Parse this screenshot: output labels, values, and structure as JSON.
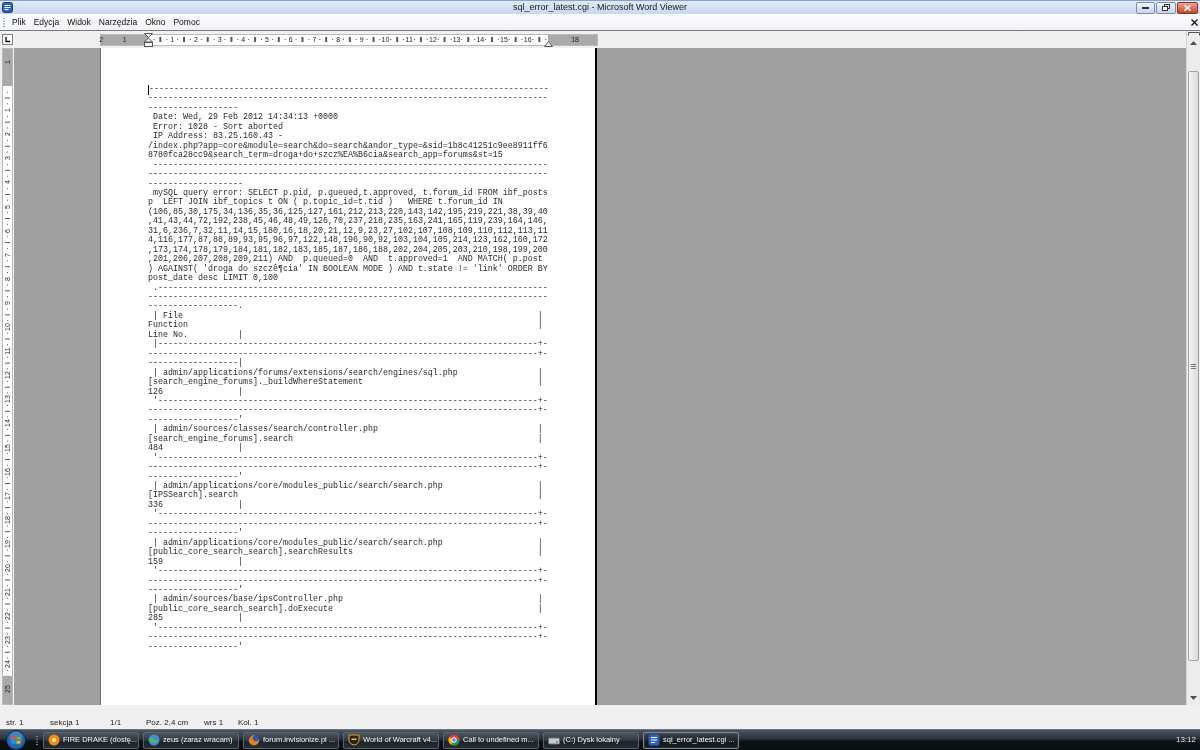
{
  "window": {
    "title": "sql_error_latest.cgi - Microsoft Word Viewer"
  },
  "menu_bar": {
    "items": [
      "Plik",
      "Edycja",
      "Widok",
      "Narzędzia",
      "Okno",
      "Pomoc"
    ]
  },
  "horizontal_ruler": {
    "left_margin_labels": [
      "2",
      "1"
    ],
    "labels": [
      "1",
      "2",
      "3",
      "4",
      "5",
      "6",
      "7",
      "8",
      "9",
      "10",
      "11",
      "12",
      "13",
      "14",
      "15",
      "16"
    ],
    "right_margin_labels": [
      "18"
    ]
  },
  "vertical_ruler": {
    "top_margin_labels": [
      "1"
    ],
    "labels": [
      "1",
      "2",
      "3",
      "4",
      "5",
      "6",
      "7",
      "8",
      "9",
      "10",
      "11",
      "12",
      "13",
      "14",
      "15",
      "16",
      "17",
      "18",
      "19",
      "20",
      "21",
      "22",
      "23",
      "24"
    ],
    "bottom_margin_labels": [
      "25"
    ]
  },
  "document": {
    "lines": [
      "--------------------------------------------------------------------------------",
      "--------------------------------------------------------------------------------",
      "------------------",
      " Date: Wed, 29 Feb 2012 14:34:13 +0000",
      " Error: 1028 - Sort aborted",
      " IP Address: 83.25.160.43 -",
      "/index.php?app=core&module=search&do=search&andor_type=&sid=1b8c41251c9ee8911ff6",
      "8780fca28cc9&search_term=droga+do+szcz%EA%B6cia&search_app=forums&st=15",
      " -------------------------------------------------------------------------------",
      "--------------------------------------------------------------------------------",
      "-------------------",
      " mySQL query error: SELECT p.pid, p.queued,t.approved, t.forum_id FROM ibf_posts",
      "p  LEFT JOIN ibf_topics t ON ( p.topic_id=t.tid )   WHERE t.forum_id IN",
      "(106,85,30,175,34,136,35,36,125,127,161,212,213,220,143,142,195,219,221,38,39,40",
      ",41,43,44,72,192,238,45,46,48,49,126,70,237,218,235,163,241,165,119,239,164,146,",
      "31,6,236,7,32,11,14,15,180,16,18,20,21,12,9,23,27,102,107,108,109,110,112,113,11",
      "4,116,177,87,88,89,93,95,96,97,122,148,196,90,92,103,104,105,214,123,162,160,172",
      ",173,174,178,179,184,181,182,183,185,187,186,188,202,204,205,203,210,198,199,200",
      ",201,206,207,208,209,211) AND  p.queued=0  AND  t.approved=1  AND MATCH( p.post",
      ") AGAINST( 'droga do szczê¶cia' IN BOOLEAN MODE ) AND t.state != 'link' ORDER BY",
      "post_date desc LIMIT 0,100",
      " .------------------------------------------------------------------------------",
      "--------------------------------------------------------------------------------",
      "------------------.",
      " | File                                                                       |",
      "Function                                                                      |",
      "Line No.          |",
      " |----------------------------------------------------------------------------+-",
      "------------------------------------------------------------------------------+-",
      "------------------|",
      " | admin/applications/forums/extensions/search/engines/sql.php                |",
      "[search_engine_forums]._buildWhereStatement                                   |",
      "126               |",
      " '----------------------------------------------------------------------------+-",
      "------------------------------------------------------------------------------+-",
      "------------------'",
      " | admin/sources/classes/search/controller.php                                |",
      "[search_engine_forums].search                                                 |",
      "484               |",
      " '----------------------------------------------------------------------------+-",
      "------------------------------------------------------------------------------+-",
      "------------------'",
      " | admin/applications/core/modules_public/search/search.php                   |",
      "[IPSSearch].search                                                            |",
      "336               |",
      " '----------------------------------------------------------------------------+-",
      "------------------------------------------------------------------------------+-",
      "------------------'",
      " | admin/applications/core/modules_public/search/search.php                   |",
      "[public_core_search_search].searchResults                                     |",
      "159               |",
      " '----------------------------------------------------------------------------+-",
      "------------------------------------------------------------------------------+-",
      "------------------'",
      " | admin/sources/base/ipsController.php                                       |",
      "[public_core_search_search].doExecute                                         |",
      "285               |",
      " '----------------------------------------------------------------------------+-",
      "------------------------------------------------------------------------------+-",
      "------------------'"
    ]
  },
  "status_bar": {
    "items": [
      "str. 1",
      "sekcja 1",
      "1/1",
      "Poz. 2,4 cm",
      "wrs 1",
      "Kol. 1"
    ]
  },
  "taskbar": {
    "buttons": [
      {
        "label": "FIRE DRAKE (dostę...",
        "kind": "chat",
        "selected": false
      },
      {
        "label": "zeus (zaraz wracam)",
        "kind": "status",
        "selected": false
      },
      {
        "label": "forum.invisionize.pl ...",
        "kind": "browser",
        "selected": false
      },
      {
        "label": "World of Warcraft v4...",
        "kind": "game",
        "selected": false
      },
      {
        "label": "Call to undefined m...",
        "kind": "web",
        "selected": false
      },
      {
        "label": "(C:) Dysk lokalny",
        "kind": "drive",
        "selected": false
      },
      {
        "label": "sql_error_latest.cgi ...",
        "kind": "document",
        "selected": true
      }
    ],
    "clock": "13:12"
  }
}
